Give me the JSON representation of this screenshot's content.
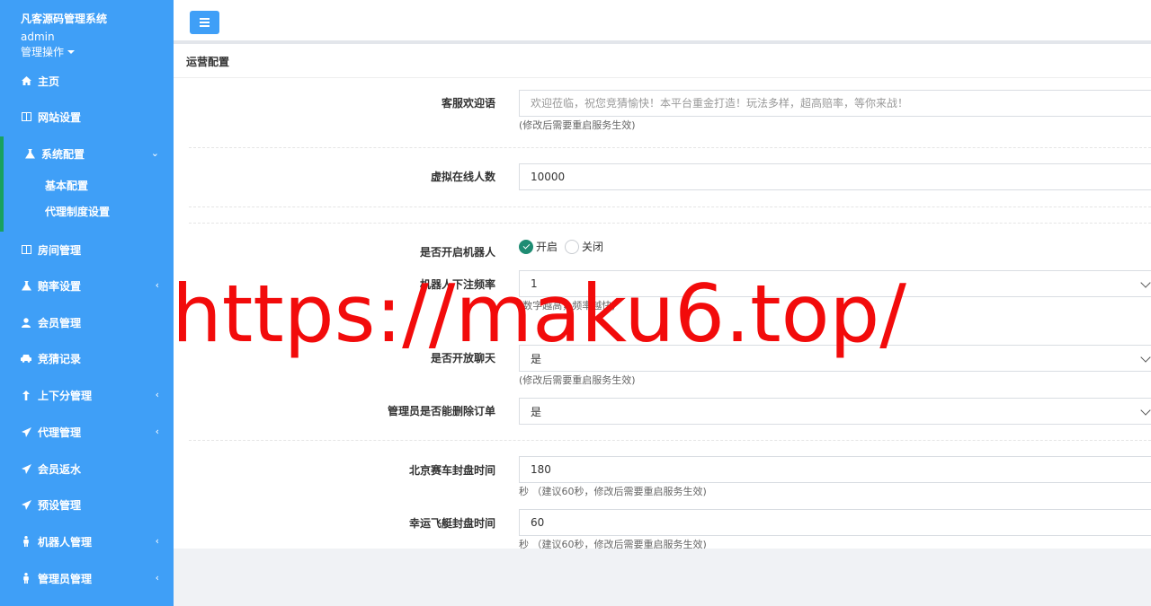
{
  "app": {
    "brand": "凡客源码管理系统",
    "user": "admin",
    "user_menu": "管理操作"
  },
  "colors": {
    "sidebar": "#3f9ff7",
    "active_bar": "#19a15f",
    "radio_on": "#1e8c73",
    "watermark": "#f20b0b"
  },
  "sidebar": {
    "items": [
      {
        "label": "主页",
        "icon": "home-icon"
      },
      {
        "label": "网站设置",
        "icon": "columns-icon"
      },
      {
        "label": "系统配置",
        "icon": "flask-icon",
        "chevron": "⌄"
      },
      {
        "label": "房间管理",
        "icon": "columns-icon"
      },
      {
        "label": "赔率设置",
        "icon": "flask-icon",
        "chevron": "‹"
      },
      {
        "label": "会员管理",
        "icon": "user-icon"
      },
      {
        "label": "竞猜记录",
        "icon": "car-icon"
      },
      {
        "label": "上下分管理",
        "icon": "arrow-up-icon",
        "chevron": "‹"
      },
      {
        "label": "代理管理",
        "icon": "send-icon",
        "chevron": "‹"
      },
      {
        "label": "会员返水",
        "icon": "send-icon"
      },
      {
        "label": "预设管理",
        "icon": "send-icon"
      },
      {
        "label": "机器人管理",
        "icon": "person-icon",
        "chevron": "‹"
      },
      {
        "label": "管理员管理",
        "icon": "person-icon",
        "chevron": "‹"
      }
    ],
    "subitems": [
      {
        "label": "基本配置"
      },
      {
        "label": "代理制度设置"
      }
    ]
  },
  "panel": {
    "title": "运营配置",
    "welcome": {
      "label": "客服欢迎语",
      "placeholder": "欢迎莅临，祝您竞猜愉快！本平台重金打造！玩法多样，超高赔率，等你来战！",
      "hint": "(修改后需要重启服务生效)"
    },
    "online": {
      "label": "虚拟在线人数",
      "value": "10000"
    },
    "robot": {
      "label": "是否开启机器人",
      "on": "开启",
      "off": "关闭"
    },
    "robot_freq": {
      "label": "机器人下注频率",
      "value": "1",
      "hint": "(数字越高，频率越快)"
    },
    "chat": {
      "label": "是否开放聊天",
      "value": "是",
      "hint": "(修改后需要重启服务生效)"
    },
    "admin_delete": {
      "label": "管理员是否能删除订单",
      "value": "是"
    },
    "bj_close": {
      "label": "北京赛车封盘时间",
      "value": "180",
      "hint": "秒 （建议60秒，修改后需要重启服务生效)"
    },
    "xy_close": {
      "label": "幸运飞艇封盘时间",
      "value": "60",
      "hint": "秒 （建议60秒，修改后需要重启服务生效)"
    }
  },
  "watermark": "https://maku6.top/"
}
